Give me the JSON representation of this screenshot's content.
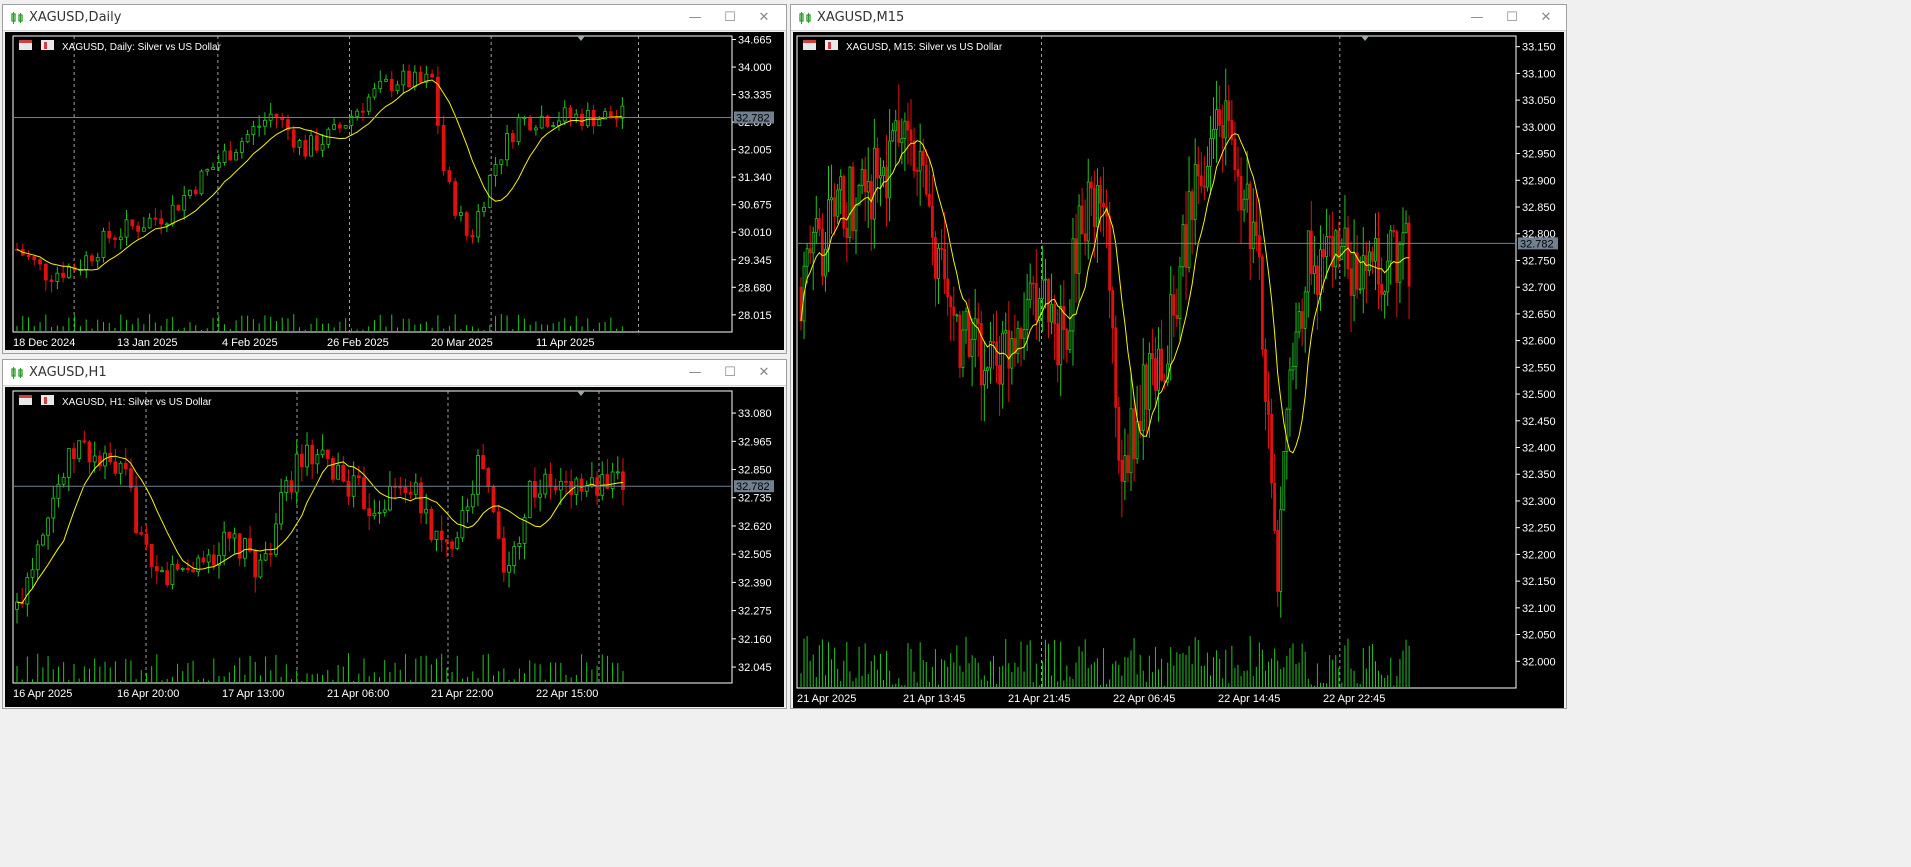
{
  "windows": [
    {
      "id": "daily",
      "title": "XAGUSD,Daily",
      "chart_info": "XAGUSD, Daily:  Silver vs US Dollar",
      "current_price": "32.782",
      "current_price_value": 32.782,
      "y_ticks": [
        "34.665",
        "34.000",
        "33.335",
        "32.670",
        "32.005",
        "31.340",
        "30.675",
        "30.010",
        "29.345",
        "28.680",
        "28.015"
      ],
      "y_range": [
        27.6,
        34.75
      ],
      "x_labels": [
        "18 Dec 2024",
        "13 Jan 2025",
        "4 Feb 2025",
        "26 Feb 2025",
        "20 Mar 2025",
        "11 Apr 2025"
      ]
    },
    {
      "id": "h1",
      "title": "XAGUSD,H1",
      "chart_info": "XAGUSD, H1:  Silver vs US Dollar",
      "current_price": "32.782",
      "current_price_value": 32.782,
      "y_ticks": [
        "33.080",
        "32.965",
        "32.850",
        "32.735",
        "32.620",
        "32.505",
        "32.390",
        "32.275",
        "32.160",
        "32.045"
      ],
      "y_range": [
        31.98,
        33.17
      ],
      "x_labels": [
        "16 Apr 2025",
        "16 Apr 20:00",
        "17 Apr 13:00",
        "21 Apr 06:00",
        "21 Apr 22:00",
        "22 Apr 15:00"
      ]
    },
    {
      "id": "m15",
      "title": "XAGUSD,M15",
      "chart_info": "XAGUSD, M15:  Silver vs US Dollar",
      "current_price": "32.782",
      "current_price_value": 32.782,
      "y_ticks": [
        "33.150",
        "33.100",
        "33.050",
        "33.000",
        "32.950",
        "32.900",
        "32.850",
        "32.800",
        "32.750",
        "32.700",
        "32.650",
        "32.600",
        "32.550",
        "32.500",
        "32.450",
        "32.400",
        "32.350",
        "32.300",
        "32.250",
        "32.200",
        "32.150",
        "32.100",
        "32.050",
        "32.000"
      ],
      "y_range": [
        31.95,
        33.17
      ],
      "x_labels": [
        "21 Apr 2025",
        "21 Apr 13:45",
        "21 Apr 21:45",
        "22 Apr 06:45",
        "22 Apr 14:45",
        "22 Apr 22:45"
      ]
    }
  ],
  "colors": {
    "bull": "#22c322",
    "bear": "#e01010",
    "ma": "#f5f500",
    "grid": "#c8c8c8",
    "price_line": "#708090",
    "volume": "#22c322",
    "axis_text": "#ffffff"
  },
  "icons": [
    "candlestick-icon",
    "minimize-icon",
    "maximize-icon",
    "close-icon"
  ],
  "window_controls": {
    "minimize": "—",
    "maximize": "☐",
    "close": "✕"
  }
}
